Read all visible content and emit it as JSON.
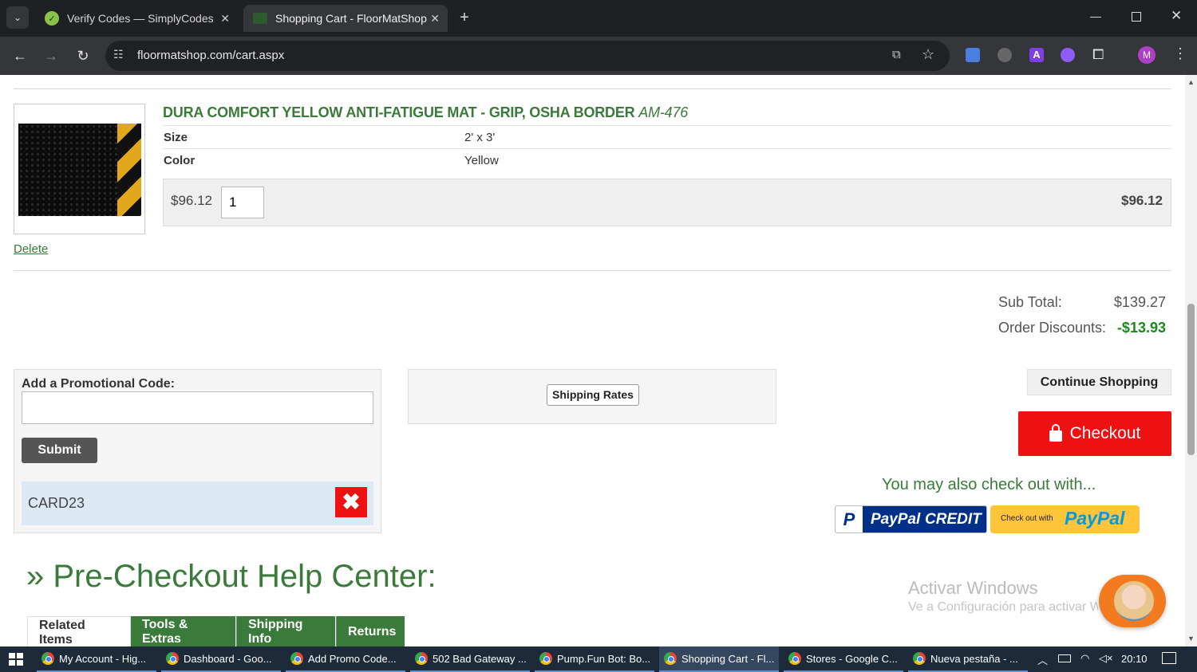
{
  "browser": {
    "tabs": [
      {
        "title": "Verify Codes — SimplyCodes",
        "active": false
      },
      {
        "title": "Shopping Cart - FloorMatShop",
        "active": true
      }
    ],
    "url": "floormatshop.com/cart.aspx",
    "profile_initial": "M"
  },
  "cart": {
    "item": {
      "name": "DURA COMFORT YELLOW ANTI-FATIGUE MAT - GRIP, OSHA BORDER",
      "sku": "AM-476",
      "attributes": [
        {
          "label": "Size",
          "value": "2' x 3'"
        },
        {
          "label": "Color",
          "value": "Yellow"
        }
      ],
      "unit_price": "$96.12",
      "quantity": "1",
      "line_total": "$96.12",
      "delete_label": "Delete"
    },
    "totals": {
      "subtotal_label": "Sub Total:",
      "subtotal_value": "$139.27",
      "discount_label": "Order Discounts:",
      "discount_value": "-$13.93"
    }
  },
  "promo": {
    "label": "Add a Promotional Code:",
    "input_value": "",
    "submit_label": "Submit",
    "applied_code": "CARD23"
  },
  "shipping": {
    "button_label": "Shipping Rates"
  },
  "actions": {
    "continue_label": "Continue Shopping",
    "checkout_label": "Checkout",
    "also_checkout": "You may also check out with...",
    "paypal_credit_brand": "PayPal",
    "paypal_credit_word": "CREDIT",
    "paypal_checkout_prefix": "Check out with",
    "paypal_checkout_brand": "PayPal"
  },
  "help": {
    "title": "» Pre-Checkout Help Center:",
    "tabs": [
      "Related Items",
      "Tools & Extras",
      "Shipping Info",
      "Returns"
    ]
  },
  "watermark": {
    "line1": "Activar Windows",
    "line2": "Ve a Configuración para activar W"
  },
  "taskbar": {
    "items": [
      "My Account - Hig...",
      "Dashboard - Goo...",
      "Add Promo Code...",
      "502 Bad Gateway ...",
      "Pump.Fun Bot: Bo...",
      "Shopping Cart - Fl...",
      "Stores - Google C...",
      "Nueva pestaña - ..."
    ],
    "clock": "20:10"
  },
  "colors": {
    "accent_green": "#3a7a3a",
    "checkout_red": "#ee1111",
    "discount_green": "#1a8a1a"
  }
}
